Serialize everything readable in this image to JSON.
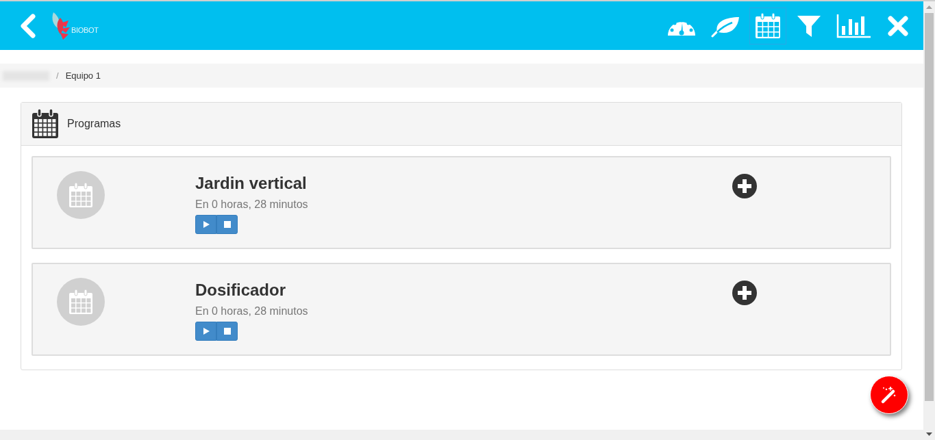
{
  "header": {
    "logo_text": "BIOBOT",
    "nav": [
      {
        "kind": "gauge",
        "selected": false
      },
      {
        "kind": "leaf",
        "selected": false
      },
      {
        "kind": "calendar",
        "selected": true
      },
      {
        "kind": "filter",
        "selected": false
      },
      {
        "kind": "chart",
        "selected": false
      },
      {
        "kind": "close",
        "selected": false
      }
    ]
  },
  "breadcrumb": {
    "separator": "/",
    "current": "Equipo 1"
  },
  "panel": {
    "title": "Programas",
    "programs": [
      {
        "name": "Jardin vertical",
        "schedule": "En 0 horas, 28 minutos"
      },
      {
        "name": "Dosificador",
        "schedule": "En 0 horas, 28 minutos"
      }
    ]
  }
}
